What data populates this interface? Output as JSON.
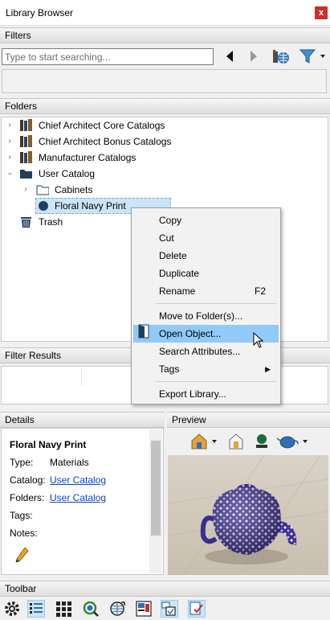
{
  "window": {
    "title": "Library Browser",
    "close_glyph": "x"
  },
  "filters": {
    "header": "Filters",
    "search_placeholder": "Type to start searching...",
    "icons": [
      "back-arrow-icon",
      "forward-arrow-icon",
      "globe-library-icon",
      "filter-funnel-icon"
    ]
  },
  "folders": {
    "header": "Folders",
    "items": [
      {
        "label": "Chief Architect Core Catalogs",
        "icon": "catalog-books-icon",
        "expanded": false
      },
      {
        "label": "Chief Architect Bonus Catalogs",
        "icon": "catalog-books-icon",
        "expanded": false
      },
      {
        "label": "Manufacturer Catalogs",
        "icon": "catalog-books-icon",
        "expanded": false
      },
      {
        "label": "User Catalog",
        "icon": "folder-filled-icon",
        "expanded": true
      },
      {
        "label": "Cabinets",
        "icon": "folder-outline-icon",
        "expanded": false
      },
      {
        "label": "Floral Navy Print",
        "icon": "material-dot-icon",
        "selected": true
      },
      {
        "label": "Trash",
        "icon": "trash-icon"
      }
    ]
  },
  "context_menu": {
    "items": [
      {
        "label": "Copy"
      },
      {
        "label": "Cut"
      },
      {
        "label": "Delete"
      },
      {
        "label": "Duplicate"
      },
      {
        "label": "Rename",
        "shortcut": "F2"
      },
      {
        "label": "Move to Folder(s)..."
      },
      {
        "label": "Open Object...",
        "highlighted": true
      },
      {
        "label": "Search Attributes..."
      },
      {
        "label": "Tags",
        "submenu": true
      },
      {
        "label": "Export Library..."
      }
    ]
  },
  "filter_results": {
    "header": "Filter Results"
  },
  "details": {
    "header": "Details",
    "name": "Floral Navy Print",
    "type_label": "Type:",
    "type_value": "Materials",
    "catalog_label": "Catalog:",
    "catalog_value": "User Catalog",
    "folders_label": "Folders:",
    "folders_value": "User Catalog",
    "tags_label": "Tags:",
    "notes_label": "Notes:"
  },
  "preview": {
    "header": "Preview"
  },
  "toolbar": {
    "header": "Toolbar",
    "icons": [
      "settings-gear-icon",
      "list-view-icon",
      "grid-view-icon",
      "search-refresh-icon",
      "globe-refresh-icon",
      "preview-panel-icon",
      "multi-view-icon",
      "checklist-icon"
    ]
  },
  "colors": {
    "selection": "#cce4f7",
    "menu_highlight": "#91c9f7",
    "link": "#0b46c4",
    "close_button": "#c9302c",
    "folder": "#1f3f5f"
  }
}
